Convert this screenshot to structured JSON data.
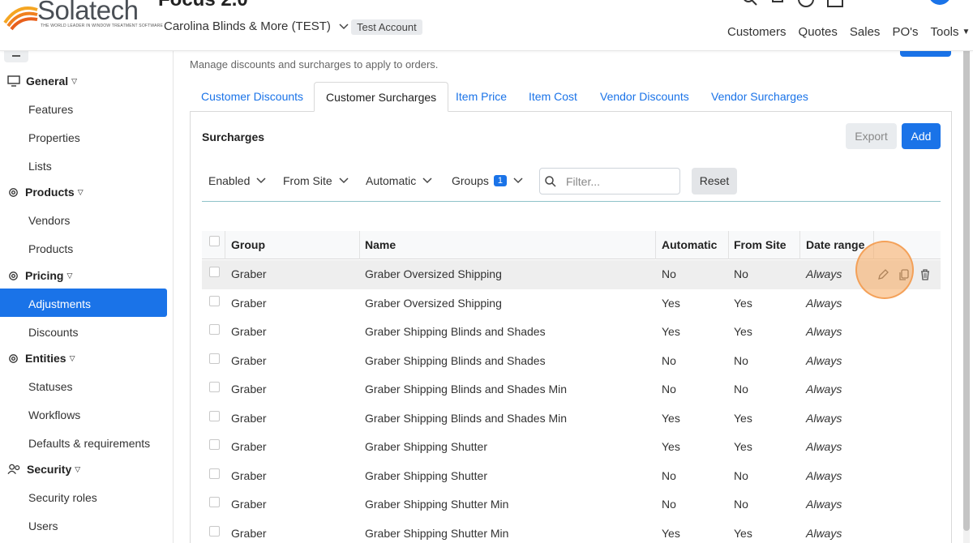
{
  "app": {
    "brand": "Solatech",
    "tagline": "THE WORLD LEADER IN WINDOW TREATMENT SOFTWARE",
    "title": "Focus 2.0",
    "account": "Carolina Blinds & More (TEST)",
    "account_badge": "Test Account"
  },
  "topnav": [
    "Customers",
    "Quotes",
    "Sales",
    "PO's",
    "Tools"
  ],
  "sidebar": {
    "sections": [
      {
        "label": "General",
        "items": [
          "Features",
          "Properties",
          "Lists"
        ]
      },
      {
        "label": "Products",
        "items": [
          "Vendors",
          "Products"
        ]
      },
      {
        "label": "Pricing",
        "items": [
          "Adjustments",
          "Discounts"
        ]
      },
      {
        "label": "Entities",
        "items": [
          "Statuses",
          "Workflows",
          "Defaults & requirements"
        ]
      },
      {
        "label": "Security",
        "items": [
          "Security roles",
          "Users"
        ]
      }
    ],
    "active_item": "Adjustments"
  },
  "page": {
    "subtitle": "Manage discounts and surcharges to apply to orders."
  },
  "tabs": [
    "Customer Discounts",
    "Customer Surcharges",
    "Item Price",
    "Item Cost",
    "Vendor Discounts",
    "Vendor Surcharges"
  ],
  "active_tab": "Customer Surcharges",
  "panel": {
    "title": "Surcharges",
    "export_label": "Export",
    "add_label": "Add"
  },
  "filters": {
    "enabled": "Enabled",
    "from_site": "From Site",
    "automatic": "Automatic",
    "groups": "Groups",
    "groups_count": "1",
    "search_placeholder": "Filter...",
    "reset_label": "Reset"
  },
  "table": {
    "columns": [
      "Group",
      "Name",
      "Automatic",
      "From Site",
      "Date range"
    ],
    "rows": [
      {
        "group": "Graber",
        "name": "Graber Oversized Shipping",
        "automatic": "No",
        "from_site": "No",
        "date_range": "Always"
      },
      {
        "group": "Graber",
        "name": "Graber Oversized Shipping",
        "automatic": "Yes",
        "from_site": "Yes",
        "date_range": "Always"
      },
      {
        "group": "Graber",
        "name": "Graber Shipping Blinds and Shades",
        "automatic": "Yes",
        "from_site": "Yes",
        "date_range": "Always"
      },
      {
        "group": "Graber",
        "name": "Graber Shipping Blinds and Shades",
        "automatic": "No",
        "from_site": "No",
        "date_range": "Always"
      },
      {
        "group": "Graber",
        "name": "Graber Shipping Blinds and Shades Min",
        "automatic": "No",
        "from_site": "No",
        "date_range": "Always"
      },
      {
        "group": "Graber",
        "name": "Graber Shipping Blinds and Shades Min",
        "automatic": "Yes",
        "from_site": "Yes",
        "date_range": "Always"
      },
      {
        "group": "Graber",
        "name": "Graber Shipping Shutter",
        "automatic": "Yes",
        "from_site": "Yes",
        "date_range": "Always"
      },
      {
        "group": "Graber",
        "name": "Graber Shipping Shutter",
        "automatic": "No",
        "from_site": "No",
        "date_range": "Always"
      },
      {
        "group": "Graber",
        "name": "Graber Shipping Shutter Min",
        "automatic": "No",
        "from_site": "No",
        "date_range": "Always"
      },
      {
        "group": "Graber",
        "name": "Graber Shipping Shutter Min",
        "automatic": "Yes",
        "from_site": "Yes",
        "date_range": "Always"
      }
    ],
    "hovered_row": 0
  },
  "colors": {
    "primary": "#1a73e8",
    "highlight_row": "#eeeeee",
    "cursor": "#f7aa5f"
  }
}
